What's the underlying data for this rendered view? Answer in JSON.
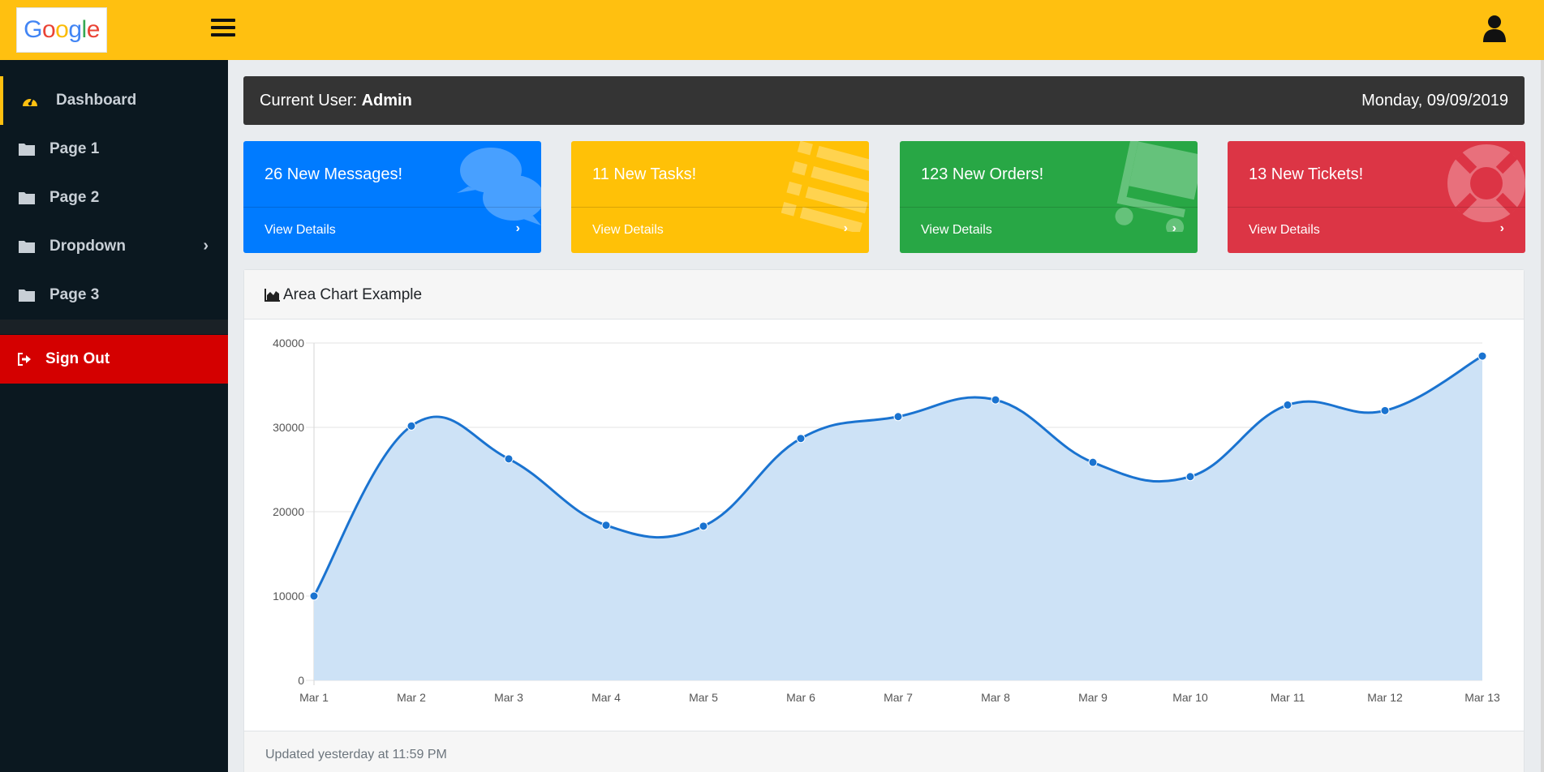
{
  "brand": {
    "logo_letters": [
      "G",
      "o",
      "o",
      "g",
      "l",
      "e"
    ],
    "logo_colors": [
      "#4285F4",
      "#EA4335",
      "#FBBC05",
      "#4285F4",
      "#34A853",
      "#EA4335"
    ]
  },
  "colors": {
    "topbar": "#ffc010",
    "sidebar": "#0b1820",
    "signout": "#d40000",
    "accent_blue": "#007bff",
    "accent_yellow": "#ffc107",
    "accent_green": "#28a745",
    "accent_red": "#dc3545",
    "series": "#1a73d0",
    "series_fill": "#cde2f6"
  },
  "sidebar": {
    "items": [
      {
        "label": "Dashboard",
        "icon": "dashboard-gauge-icon"
      },
      {
        "label": "Page 1",
        "icon": "folder-icon"
      },
      {
        "label": "Page 2",
        "icon": "folder-icon"
      },
      {
        "label": "Dropdown",
        "icon": "folder-icon",
        "chevron": "›"
      },
      {
        "label": "Page 3",
        "icon": "folder-icon"
      }
    ],
    "signout": {
      "label": "Sign Out",
      "icon": "sign-out-icon"
    }
  },
  "userbar": {
    "prefix": "Current User: ",
    "user": "Admin",
    "date": "Monday, 09/09/2019"
  },
  "cards": [
    {
      "title": "26 New Messages!",
      "link": "View Details",
      "arrow": "›",
      "icon": "comments-icon"
    },
    {
      "title": "11 New Tasks!",
      "link": "View Details",
      "arrow": "›",
      "icon": "list-icon"
    },
    {
      "title": "123 New Orders!",
      "link": "View Details",
      "arrow": "›",
      "icon": "shopping-cart-icon"
    },
    {
      "title": "13 New Tickets!",
      "link": "View Details",
      "arrow": "›",
      "icon": "life-ring-icon"
    }
  ],
  "chart_card": {
    "title": "Area Chart Example",
    "footer": "Updated yesterday at 11:59 PM"
  },
  "chart_data": {
    "type": "area",
    "categories": [
      "Mar 1",
      "Mar 2",
      "Mar 3",
      "Mar 4",
      "Mar 5",
      "Mar 6",
      "Mar 7",
      "Mar 8",
      "Mar 9",
      "Mar 10",
      "Mar 11",
      "Mar 12",
      "Mar 13"
    ],
    "series": [
      {
        "values": [
          10000,
          30162,
          26263,
          18394,
          18287,
          28682,
          31274,
          33259,
          25849,
          24159,
          32651,
          31984,
          38451
        ]
      }
    ],
    "ylim": [
      0,
      40000
    ],
    "yticks": [
      0,
      10000,
      20000,
      30000,
      40000
    ],
    "grid": true,
    "legend": "none"
  }
}
